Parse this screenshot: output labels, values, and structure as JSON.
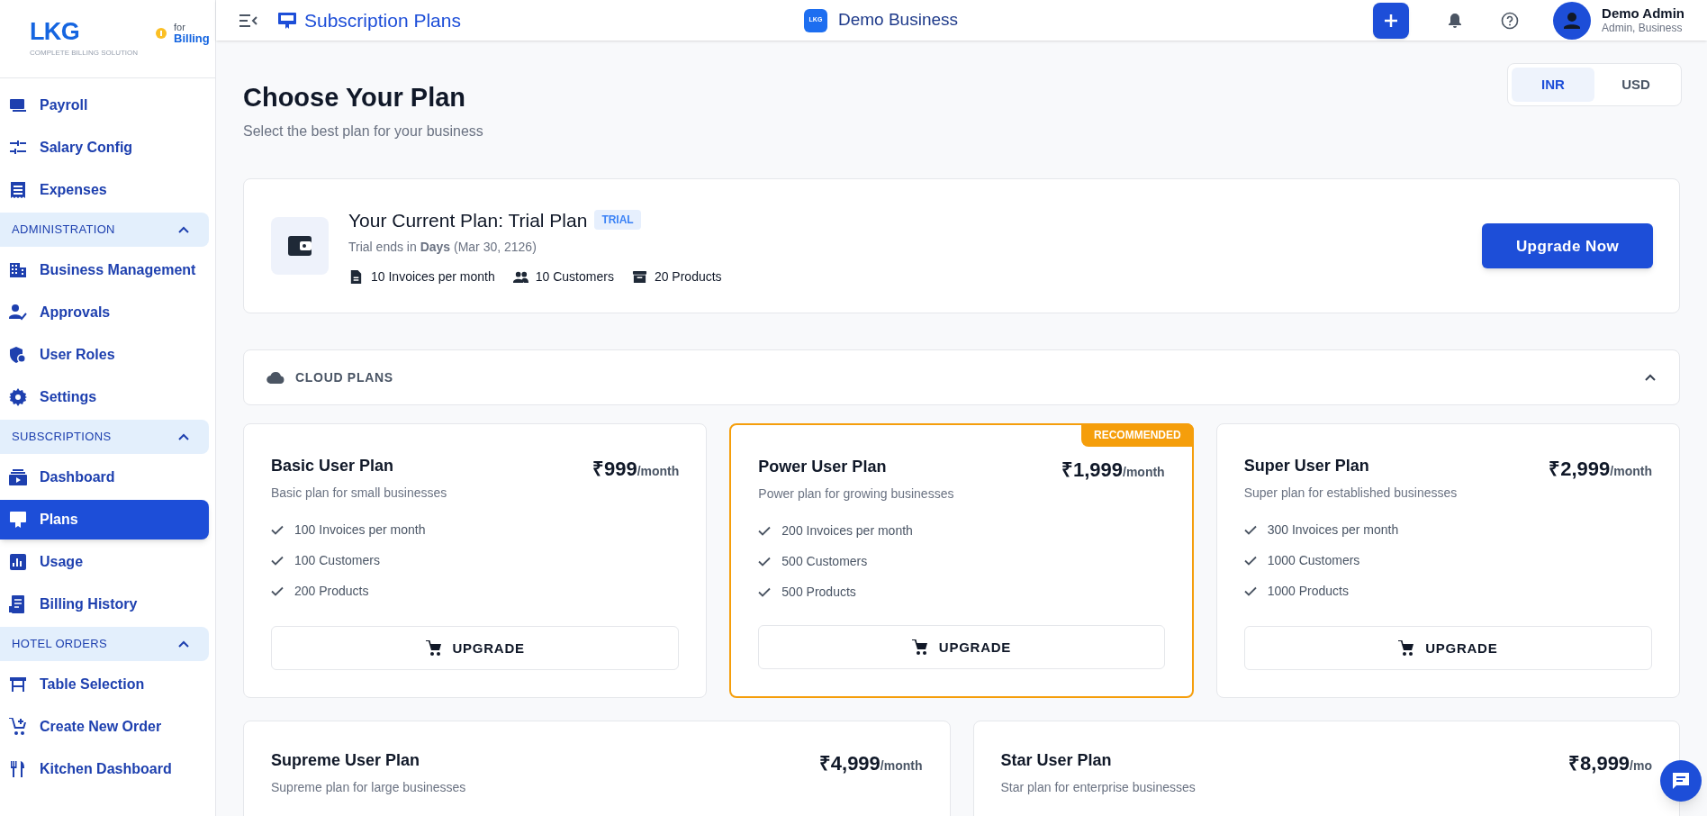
{
  "sidebar": {
    "logo": {
      "mark": "LKG",
      "tagline": "COMPLETE BILLING SOLUTION",
      "for": "for",
      "product": "Billing"
    },
    "items": [
      {
        "kind": "item",
        "label": "Payroll",
        "selected": false
      },
      {
        "kind": "item",
        "label": "Salary Config",
        "selected": false
      },
      {
        "kind": "item",
        "label": "Expenses",
        "selected": false
      },
      {
        "kind": "section",
        "label": "ADMINISTRATION",
        "expanded": true
      },
      {
        "kind": "item",
        "label": "Business Management",
        "selected": false
      },
      {
        "kind": "item",
        "label": "Approvals",
        "selected": false
      },
      {
        "kind": "item",
        "label": "User Roles",
        "selected": false
      },
      {
        "kind": "item",
        "label": "Settings",
        "selected": false
      },
      {
        "kind": "section",
        "label": "SUBSCRIPTIONS",
        "expanded": true
      },
      {
        "kind": "item",
        "label": "Dashboard",
        "selected": false
      },
      {
        "kind": "item",
        "label": "Plans",
        "selected": true
      },
      {
        "kind": "item",
        "label": "Usage",
        "selected": false
      },
      {
        "kind": "item",
        "label": "Billing History",
        "selected": false
      },
      {
        "kind": "section",
        "label": "HOTEL ORDERS",
        "expanded": true
      },
      {
        "kind": "item",
        "label": "Table Selection",
        "selected": false
      },
      {
        "kind": "item",
        "label": "Create New Order",
        "selected": false
      },
      {
        "kind": "item",
        "label": "Kitchen Dashboard",
        "selected": false
      }
    ]
  },
  "header": {
    "title": "Subscription Plans",
    "business_logo": "LKG",
    "business": "Demo Business",
    "user": {
      "name": "Demo Admin",
      "role": "Admin, Business"
    }
  },
  "page": {
    "title": "Choose Your Plan",
    "subtitle": "Select the best plan for your business",
    "currency": [
      {
        "label": "INR",
        "selected": true
      },
      {
        "label": "USD",
        "selected": false
      }
    ]
  },
  "current_plan": {
    "title": "Your Current Plan: Trial Plan",
    "badge": "TRIAL",
    "trial_text": "Trial ends in **Days** (Mar 30, 2126)",
    "limits": [
      "10 Invoices per month",
      "10 Customers",
      "20 Products"
    ],
    "button": "Upgrade Now"
  },
  "cloud_plans": {
    "label": "CLOUD PLANS",
    "expanded": true
  },
  "plans": [
    {
      "name": "Basic User Plan",
      "description": "Basic plan for small businesses",
      "price": "₹999",
      "period": "/month",
      "recommended": false,
      "features": [
        "100 Invoices per month",
        "100 Customers",
        "200 Products"
      ],
      "button": "UPGRADE"
    },
    {
      "name": "Power User Plan",
      "description": "Power plan for growing businesses",
      "price": "₹1,999",
      "period": "/month",
      "recommended": true,
      "badge": "RECOMMENDED",
      "features": [
        "200 Invoices per month",
        "500 Customers",
        "500 Products"
      ],
      "button": "UPGRADE"
    },
    {
      "name": "Super User Plan",
      "description": "Super plan for established businesses",
      "price": "₹2,999",
      "period": "/month",
      "recommended": false,
      "features": [
        "300 Invoices per month",
        "1000 Customers",
        "1000 Products"
      ],
      "button": "UPGRADE"
    },
    {
      "name": "Supreme User Plan",
      "description": "Supreme plan for large businesses",
      "price": "₹4,999",
      "period": "/month",
      "recommended": false
    },
    {
      "name": "Star User Plan",
      "description": "Star plan for enterprise businesses",
      "price": "₹8,999",
      "period": "/mo",
      "recommended": false
    }
  ]
}
